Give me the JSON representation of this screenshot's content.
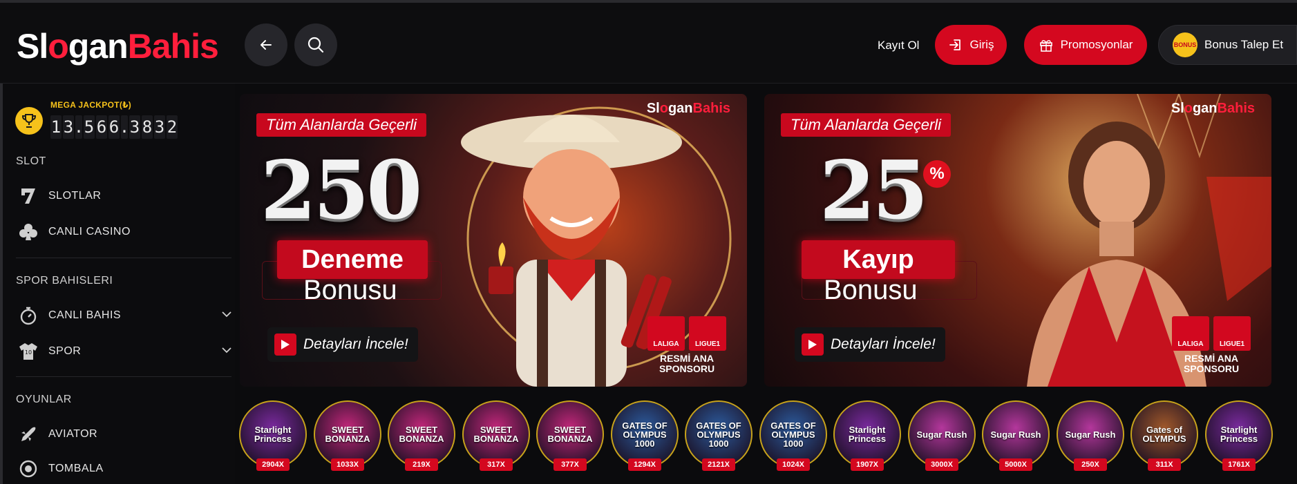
{
  "header": {
    "logo_white": "Sl",
    "logo_o": "o",
    "logo_rest_white": "gan",
    "logo_red": "Bahis",
    "register_label": "Kayıt Ol",
    "login_label": "Giriş",
    "promotions_label": "Promosyonlar",
    "bonus_request_label": "Bonus Talep Et",
    "bonus_badge": "BONUS"
  },
  "sidebar": {
    "jackpot_label": "MEGA JACKPOT(₺)",
    "jackpot_digits": [
      "1",
      "3",
      ".",
      "5",
      "6",
      "6",
      ".",
      "3",
      "8",
      "3",
      "2"
    ],
    "sections": [
      {
        "title": "SLOT",
        "items": [
          {
            "label": "SLOTLAR",
            "icon": "seven-icon"
          },
          {
            "label": "CANLI CASINO",
            "icon": "club-icon"
          }
        ]
      },
      {
        "title": "SPOR BAHISLERI",
        "items": [
          {
            "label": "CANLI BAHIS",
            "icon": "stopwatch-icon"
          },
          {
            "label": "SPOR",
            "icon": "jersey-icon"
          }
        ]
      },
      {
        "title": "OYUNLAR",
        "items": [
          {
            "label": "AVIATOR",
            "icon": "plane-icon"
          },
          {
            "label": "TOMBALA",
            "icon": "bingo-icon"
          }
        ]
      }
    ]
  },
  "banners": [
    {
      "tag": "Tüm Alanlarda Geçerli",
      "brand_white": "Sl",
      "brand_white2": "gan",
      "brand_red": "Bahis",
      "big": "250",
      "pct": "",
      "highlight": "Deneme",
      "sub": "Bonusu",
      "cta": "Detayları İncele!",
      "sponsor_laliga": "LALIGA",
      "sponsor_ligue": "LIGUE1",
      "sponsor_text_1": "RESMİ ANA",
      "sponsor_text_2": "SPONSORU"
    },
    {
      "tag": "Tüm Alanlarda Geçerli",
      "brand_white": "Sl",
      "brand_white2": "gan",
      "brand_red": "Bahis",
      "big": "25",
      "pct": "%",
      "highlight": "Kayıp",
      "sub": "Bonusu",
      "cta": "Detayları İncele!",
      "sponsor_laliga": "LALIGA",
      "sponsor_ligue": "LIGUE1",
      "sponsor_text_1": "RESMİ ANA",
      "sponsor_text_2": "SPONSORU"
    }
  ],
  "games": [
    {
      "name": "Starlight Princess",
      "mult": "2904X",
      "color": "#7a2a9e"
    },
    {
      "name": "SWEET BONANZA",
      "mult": "1033X",
      "color": "#c2277a"
    },
    {
      "name": "SWEET BONANZA",
      "mult": "219X",
      "color": "#c2277a"
    },
    {
      "name": "SWEET BONANZA",
      "mult": "317X",
      "color": "#c2277a"
    },
    {
      "name": "SWEET BONANZA",
      "mult": "377X",
      "color": "#c2277a"
    },
    {
      "name": "GATES OF OLYMPUS 1000",
      "mult": "1294X",
      "color": "#2c5a9c"
    },
    {
      "name": "GATES OF OLYMPUS 1000",
      "mult": "2121X",
      "color": "#2c5a9c"
    },
    {
      "name": "GATES OF OLYMPUS 1000",
      "mult": "1024X",
      "color": "#2c5a9c"
    },
    {
      "name": "Starlight Princess",
      "mult": "1907X",
      "color": "#7a2a9e"
    },
    {
      "name": "Sugar Rush",
      "mult": "3000X",
      "color": "#b4379c"
    },
    {
      "name": "Sugar Rush",
      "mult": "5000X",
      "color": "#b4379c"
    },
    {
      "name": "Sugar Rush",
      "mult": "250X",
      "color": "#b4379c"
    },
    {
      "name": "Gates of OLYMPUS",
      "mult": "311X",
      "color": "#a0582a"
    },
    {
      "name": "Starlight Princess",
      "mult": "1761X",
      "color": "#7a2a9e"
    }
  ]
}
